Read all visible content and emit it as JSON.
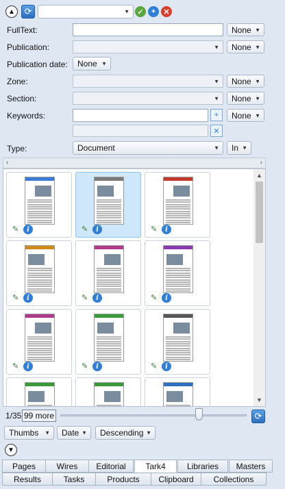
{
  "toolbar": {
    "query_select_value": "",
    "collapse_icon": "chevron-up-icon",
    "refresh_icon": "refresh-icon"
  },
  "fields": {
    "fulltext": {
      "label": "FullText:",
      "value": "",
      "op": "None"
    },
    "publication": {
      "label": "Publication:",
      "value": "",
      "op": "None"
    },
    "pubdate": {
      "label": "Publication date:",
      "op": "None"
    },
    "zone": {
      "label": "Zone:",
      "value": "",
      "op": "None"
    },
    "section": {
      "label": "Section:",
      "value": "",
      "op": "None"
    },
    "keywords": {
      "label": "Keywords:",
      "value": "",
      "value2": "",
      "op": "None"
    },
    "type": {
      "label": "Type:",
      "value": "Document",
      "op": "In"
    }
  },
  "thumbnails": [
    {
      "accent": "#3a7bd5",
      "selected": false
    },
    {
      "accent": "#7a7a7a",
      "selected": true
    },
    {
      "accent": "#c0392b",
      "selected": false
    },
    {
      "accent": "#d08a1a",
      "selected": false
    },
    {
      "accent": "#b03a8a",
      "selected": false
    },
    {
      "accent": "#8a3ab0",
      "selected": false
    },
    {
      "accent": "#b03a8a",
      "selected": false
    },
    {
      "accent": "#3a9a3a",
      "selected": false
    },
    {
      "accent": "#555555",
      "selected": false
    },
    {
      "accent": "#3a9a3a",
      "selected": false
    },
    {
      "accent": "#3a9a3a",
      "selected": false
    },
    {
      "accent": "#2f6fc0",
      "selected": false
    }
  ],
  "pager": {
    "position": "1/35",
    "more_label": "99 more"
  },
  "sort": {
    "view": "Thumbs",
    "field": "Date",
    "order": "Descending"
  },
  "tabs_row1": [
    "Pages",
    "Wires",
    "Editorial",
    "Tark4",
    "Libraries",
    "Masters"
  ],
  "tabs_row2": [
    "Results",
    "Tasks",
    "Products",
    "Clipboard",
    "Collections"
  ],
  "active_tab": "Tark4"
}
